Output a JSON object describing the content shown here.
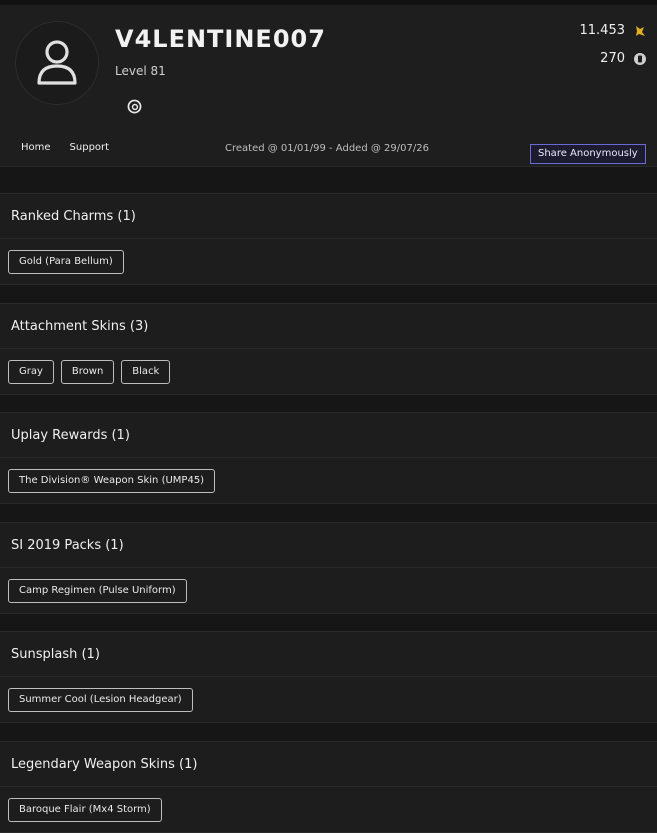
{
  "profile": {
    "username": "V4LENTINE007",
    "level": "Level 81"
  },
  "currencies": [
    {
      "value": "11.453",
      "icon": "renown-icon",
      "color": "#e0b020"
    },
    {
      "value": "270",
      "icon": "r6-credits-icon",
      "color": "#cfcfcf"
    }
  ],
  "nav": {
    "home": "Home",
    "support": "Support"
  },
  "created_text": "Created @ 01/01/99 - Added @ 29/07/26",
  "share_label": "Share Anonymously",
  "sections": [
    {
      "title": "Ranked Charms (1)",
      "items": [
        "Gold (Para Bellum)"
      ]
    },
    {
      "title": "Attachment Skins (3)",
      "items": [
        "Gray",
        "Brown",
        "Black"
      ]
    },
    {
      "title": "Uplay Rewards (1)",
      "items": [
        "The Division® Weapon Skin (UMP45)"
      ]
    },
    {
      "title": "SI 2019 Packs (1)",
      "items": [
        "Camp Regimen (Pulse Uniform)"
      ]
    },
    {
      "title": "Sunsplash (1)",
      "items": [
        "Summer Cool (Lesion Headgear)"
      ]
    },
    {
      "title": "Legendary Weapon Skins (1)",
      "items": [
        "Baroque Flair (Mx4 Storm)"
      ]
    }
  ]
}
